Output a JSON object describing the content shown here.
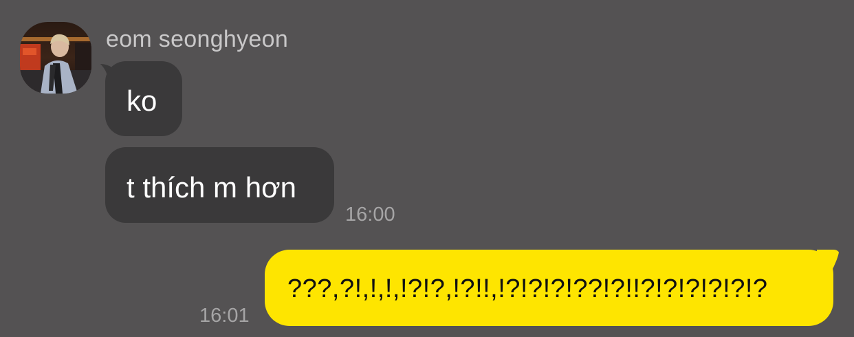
{
  "chat": {
    "sender_name": "eom seonghyeon",
    "incoming_messages": [
      {
        "text": "ko"
      },
      {
        "text": "t thích m hơn"
      }
    ],
    "incoming_time": "16:00",
    "outgoing_message": {
      "text": "???,?!,!,!,!?!?,!?!!,!?!?!?!??!?!!?!?!?!?!?!?"
    },
    "outgoing_time": "16:01"
  },
  "colors": {
    "background": "#545253",
    "incoming_bubble": "#3a393a",
    "outgoing_bubble": "#fee500"
  }
}
